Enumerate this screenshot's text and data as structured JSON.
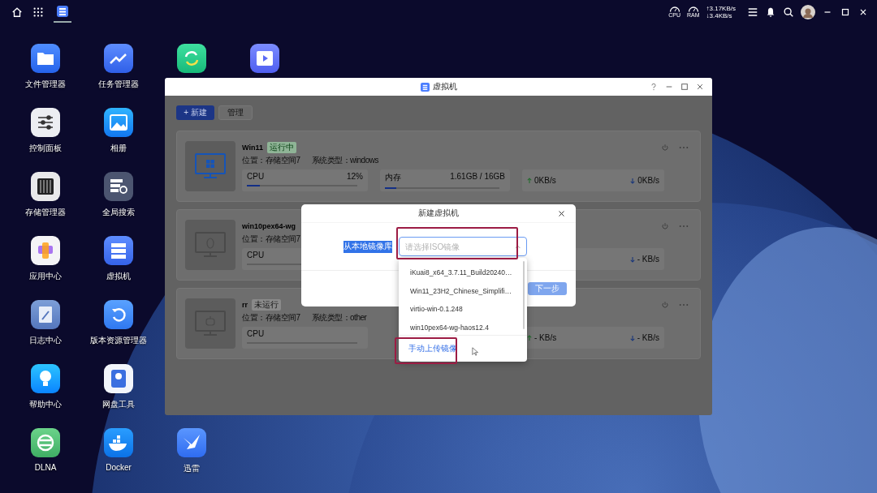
{
  "top_bar": {
    "pinned_apps": [
      {
        "kind": "vm",
        "selected": true
      }
    ],
    "gauges": [
      {
        "label": "CPU"
      },
      {
        "label": "RAM"
      }
    ],
    "net_speed": {
      "up": "↑3.17KB/s",
      "down": "↓3.4KB/s"
    }
  },
  "desktop": {
    "columns": [
      [
        {
          "kind": "folder",
          "label": "文件管理器"
        },
        {
          "kind": "sliders",
          "label": "控制面板"
        },
        {
          "kind": "storage",
          "label": "存储管理器"
        },
        {
          "kind": "apps",
          "label": "应用中心"
        },
        {
          "kind": "log",
          "label": "日志中心"
        },
        {
          "kind": "bulb",
          "label": "帮助中心"
        },
        {
          "kind": "dlna",
          "label": "DLNA"
        }
      ],
      [
        {
          "kind": "chart",
          "label": "任务管理器"
        },
        {
          "kind": "photo",
          "label": "相册"
        },
        {
          "kind": "search",
          "label": "全局搜索"
        },
        {
          "kind": "vm",
          "label": "虚拟机"
        },
        {
          "kind": "restore",
          "label": "版本资源管理器"
        },
        {
          "kind": "disk",
          "label": "网盘工具"
        },
        {
          "kind": "docker",
          "label": "Docker"
        }
      ],
      [
        {
          "kind": "sync"
        },
        {
          "kind": "bird",
          "label": "迅雷"
        }
      ],
      [
        {
          "kind": "video"
        }
      ]
    ]
  },
  "window": {
    "title": "虚拟机",
    "toolbar": {
      "new_button": "+ 新建",
      "manage_button": "管理"
    },
    "vms": [
      {
        "name": "Win11",
        "kind": "windows",
        "status": {
          "kind": "running",
          "label": "运行中"
        },
        "location": "位置：存储空间7",
        "system": "系统类型：windows",
        "stats": [
          {
            "kind": "cpu",
            "label": "CPU",
            "value": "12%",
            "level": 0.12
          },
          {
            "kind": "memory",
            "label": "内存",
            "value": "1.61GB / 16GB",
            "level": 0.1
          },
          {
            "kind": "network",
            "up": "0KB/s",
            "down": "0KB/s"
          }
        ]
      },
      {
        "name": "win10pex64-wg",
        "kind": "linux",
        "location": "位置：存储空间7",
        "stats": [
          {
            "kind": "cpu",
            "label": "CPU"
          },
          {
            "kind": "network",
            "down": "- KB/s"
          }
        ]
      },
      {
        "name": "rr",
        "kind": "other",
        "status": {
          "kind": "stopped",
          "label": "未运行"
        },
        "location": "位置：存储空间7",
        "system": "系统类型：other",
        "stats": [
          {
            "kind": "cpu",
            "label": "CPU"
          },
          {
            "kind": "network",
            "up": "- KB/s",
            "down": "- KB/s"
          }
        ]
      }
    ]
  },
  "dialog": {
    "title": "新建虚拟机",
    "source_label": "从本地镜像库",
    "select": {
      "placeholder": "请选择ISO镜像"
    },
    "next_button": "下一步",
    "options": [
      {
        "label": "iKuai8_x64_3.7.11_Build20240…"
      },
      {
        "label": "Win11_23H2_Chinese_Simplifi…"
      },
      {
        "label": "virtio-win-0.1.248"
      },
      {
        "label": "win10pex64-wg-haos12.4"
      }
    ],
    "upload_link": "手动上传镜像"
  }
}
